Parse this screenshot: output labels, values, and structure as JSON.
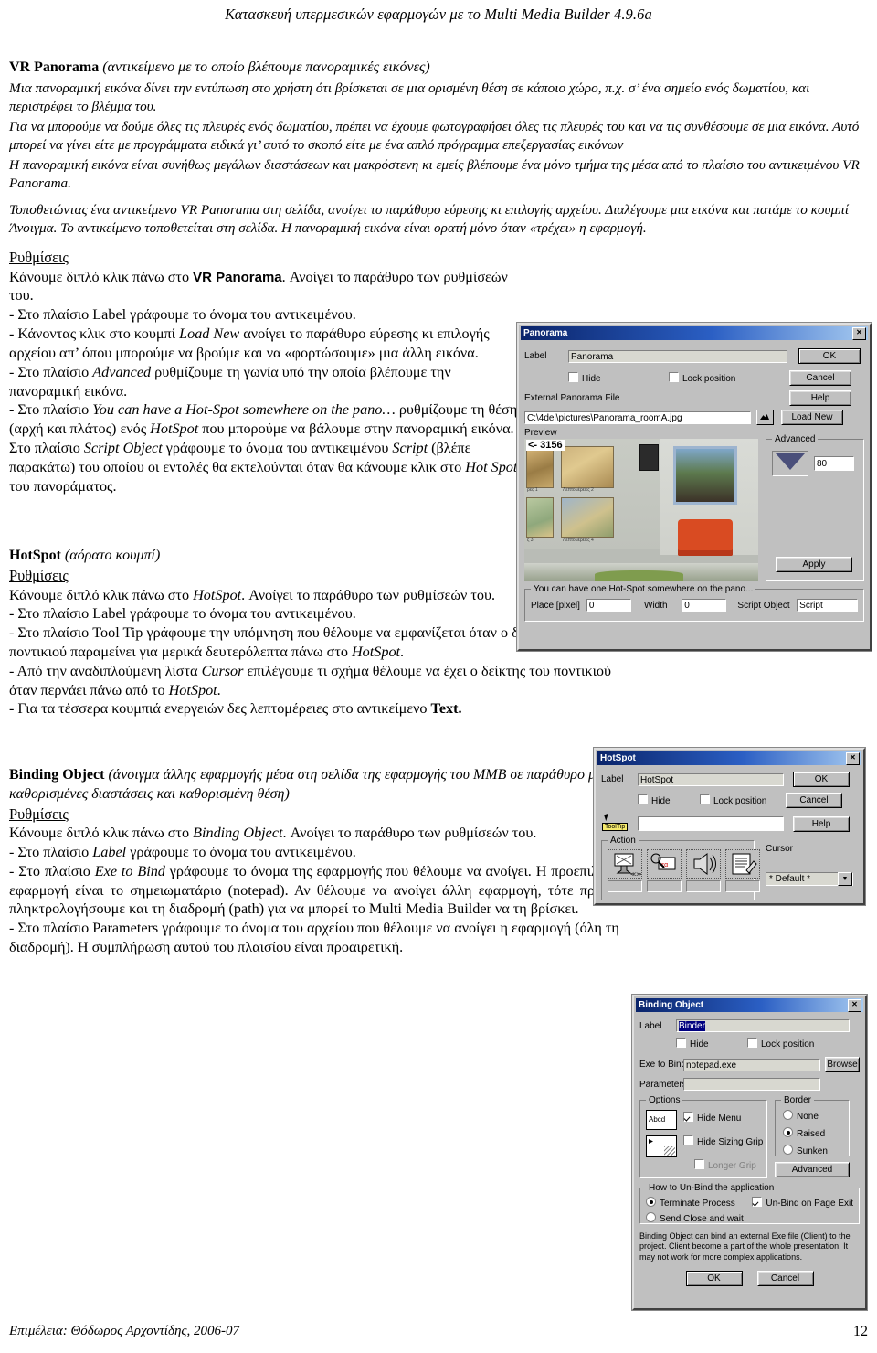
{
  "header": {
    "running_title": "Κατασκευή υπερμεσικών εφαρμογών με το Multi Media Builder 4.9.6a"
  },
  "footer": {
    "credit": "Επιμέλεια: Θόδωρος Αρχοντίδης, 2006-07",
    "page_number": "12"
  },
  "sections": {
    "vr_panorama": {
      "heading_bold": "VR Panorama",
      "heading_italic": " (αντικείμενο με το οποίο βλέπουμε πανοραμικές εικόνες)",
      "p1": "Μια πανοραμική εικόνα δίνει την εντύπωση στο χρήστη ότι βρίσκεται σε μια ορισμένη θέση σε κάποιο χώρο, π.χ. σ’ ένα σημείο ενός δωματίου, και περιστρέφει το βλέμμα του.",
      "p2": "Για να μπορούμε να δούμε όλες τις πλευρές ενός δωματίου, πρέπει να έχουμε φωτογραφήσει όλες τις πλευρές του και να τις συνθέσουμε σε μια εικόνα. Αυτό μπορεί να γίνει είτε με προγράμματα ειδικά γι’ αυτό το σκοπό είτε με ένα απλό πρόγραμμα επεξεργασίας εικόνων",
      "p3": "Η πανοραμική εικόνα είναι συνήθως μεγάλων διαστάσεων και μακρόστενη κι εμείς βλέπουμε ένα μόνο τμήμα της μέσα από το πλαίσιο του αντικειμένου VR Panorama.",
      "p4": "Τοποθετώντας ένα αντικείμενο VR Panorama στη σελίδα, ανοίγει το παράθυρο εύρεσης κι επιλογής αρχείου. Διαλέγουμε μια εικόνα και πατάμε το κουμπί Άνοιγμα. Το αντικείμενο τοποθετείται στη σελίδα. Η πανοραμική εικόνα είναι ορατή μόνο όταν «τρέχει» η εφαρμογή.",
      "settings_label": "Ρυθμίσεις",
      "s_intro": "Κάνουμε διπλό κλικ πάνω στο VR Panorama. Ανοίγει το παράθυρο των ρυθμίσεών του.",
      "s_item1": "- Στο πλαίσιο Label γράφουμε το όνομα του αντικειμένου.",
      "s_item2_a": "- Κάνοντας κλικ στο κουμπί ",
      "s_item2_i": "Load New",
      "s_item2_b": " ανοίγει το παράθυρο εύρεσης κι επιλογής αρχείου απ’ όπου μπορούμε να βρούμε και να «φορτώσουμε» μια άλλη εικόνα.",
      "s_item3_a": "- Στο πλαίσιο ",
      "s_item3_i": "Advanced",
      "s_item3_b": " ρυθμίζουμε τη γωνία υπό την οποία βλέπουμε την πανοραμική εικόνα.",
      "s_item4_a": "- Στο πλαίσιο ",
      "s_item4_i1": "You can have a Hot-Spot somewhere on the pano…",
      "s_item4_b": " ρυθμίζουμε τη θέση (αρχή και πλάτος) ενός ",
      "s_item4_i2": "HotSpot",
      "s_item4_c": " που μπορούμε να βάλουμε στην πανοραμική εικόνα. Στο πλαίσιο ",
      "s_item4_i3": "Script Object",
      "s_item4_d": " γράφουμε το όνομα του αντικειμένου ",
      "s_item4_i4": "Script",
      "s_item4_e": " (βλέπε παρακάτω) του οποίου οι εντολές θα εκτελούνται όταν θα κάνουμε κλικ στο ",
      "s_item4_i5": "Hot Spot",
      "s_item4_f": " του πανοράματος."
    },
    "hotspot": {
      "heading_bold": "HotSpot",
      "heading_italic": " (αόρατο κουμπί)",
      "settings_label": "Ρυθμίσεις",
      "s_intro_a": "Κάνουμε διπλό κλικ πάνω στο ",
      "s_intro_i": "HotSpot",
      "s_intro_b": ". Ανοίγει το παράθυρο των ρυθμίσεών του.",
      "s_item1": "- Στο πλαίσιο Label γράφουμε το όνομα του αντικειμένου.",
      "s_item2_a": "- Στο πλαίσιο Tool Tip γράφουμε την υπόμνηση που θέλουμε να εμφανίζεται όταν ο δείκτης του ποντικιού παραμείνει για μερικά δευτερόλεπτα πάνω στο ",
      "s_item2_i": "HotSpot",
      "s_item2_b": ".",
      "s_item3_a": "- Από την αναδιπλούμενη λίστα ",
      "s_item3_i": "Cursor",
      "s_item3_b": " επιλέγουμε τι σχήμα θέλουμε να έχει ο δείκτης του ποντικιού όταν περνάει πάνω από το ",
      "s_item3_i2": "HotSpot",
      "s_item3_c": ".",
      "s_item4_a": "- Για τα τέσσερα κουμπιά ενεργειών δες λεπτομέρειες στο αντικείμενο ",
      "s_item4_b": "Text."
    },
    "binding_object": {
      "heading_bold": "Binding Object",
      "heading_italic": " (άνοιγμα άλλης εφαρμογής μέσα στη σελίδα της εφαρμογής του MMB σε παράθυρο με καθορισμένες διαστάσεις και καθορισμένη θέση)",
      "settings_label": "Ρυθμίσεις",
      "s_intro_a": "Κάνουμε διπλό κλικ πάνω στο ",
      "s_intro_i": "Binding Object",
      "s_intro_b": ". Ανοίγει το παράθυρο των ρυθμίσεών του.",
      "s_item1_a": "- Στο πλαίσιο ",
      "s_item1_i": "Label",
      "s_item1_b": " γράφουμε το όνομα του αντικειμένου.",
      "s_item2_a": "- Στο πλαίσιο ",
      "s_item2_i": "Exe to Bind",
      "s_item2_b": " γράφουμε το όνομα της εφαρμογής που θέλουμε να ανοίγει. Η προεπιλεγμένη εφαρμογή είναι το σημειωματάριο (notepad). Αν θέλουμε να ανοίγει άλλη εφαρμογή, τότε πρέπει να πληκτρολογήσουμε και τη διαδρομή  (path) για να μπορεί το Multi Media Builder να τη βρίσκει.",
      "s_item3": "- Στο πλαίσιο Parameters γράφουμε το όνομα του αρχείου που θέλουμε να ανοίγει η εφαρμογή (όλη τη διαδρομή). Η συμπλήρωση αυτού του πλαισίου είναι προαιρετική."
    }
  },
  "dialogs": {
    "panorama": {
      "title": "Panorama",
      "close_label": "✕",
      "label_caption": "Label",
      "label_value": "Panorama",
      "hide_label": "Hide",
      "lock_label": "Lock position",
      "file_caption": "External Panorama File",
      "file_value": "C:\\4del\\pictures\\Panorama_roomA.jpg",
      "preview_caption": "Preview",
      "preview_tag": "<- 3156",
      "preview_captions": [
        "ρες 1",
        "Λεπτομέρειες 2",
        "ς 3",
        "Λεπτομέρειες 4"
      ],
      "advanced_caption": "Advanced",
      "advanced_value": "80",
      "apply_label": "Apply",
      "hotspot_group": "You can have one Hot-Spot somewhere on the pano...",
      "place_caption": "Place [pixel]",
      "place_value": "0",
      "width_caption": "Width",
      "width_value": "0",
      "script_caption": "Script Object",
      "script_value": "Script",
      "buttons": [
        "OK",
        "Cancel",
        "Help",
        "Load New"
      ]
    },
    "hotspot": {
      "title": "HotSpot",
      "close_label": "✕",
      "label_caption": "Label",
      "label_value": "HotSpot",
      "hide_label": "Hide",
      "lock_label": "Lock position",
      "tooltip_tag": "ToolTip",
      "tooltip_value": "",
      "action_caption": "Action",
      "cursor_caption": "Cursor",
      "cursor_value": "* Default *",
      "buttons": [
        "OK",
        "Cancel",
        "Help"
      ]
    },
    "binding": {
      "title": "Binding Object",
      "close_label": "✕",
      "label_caption": "Label",
      "label_value": "Binder",
      "hide_label": "Hide",
      "lock_label": "Lock position",
      "exe_caption": "Exe to Bind",
      "exe_value": "notepad.exe",
      "browse_label": "Browse",
      "params_caption": "Parameters",
      "params_value": "",
      "options_caption": "Options",
      "thumb_abcd": "Abcd",
      "hide_menu_label": "Hide Menu",
      "hide_sizing_label": "Hide Sizing Grip",
      "longer_grip_label": "Longer Grip",
      "border_caption": "Border",
      "border_none": "None",
      "border_raised": "Raised",
      "border_sunken": "Sunken",
      "advanced_label": "Advanced",
      "unbind_caption": "How to Un-Bind the application",
      "terminate_label": "Terminate Process",
      "sendclose_label": "Send Close and wait",
      "unbind_page_exit_label": "Un-Bind on Page Exit",
      "note": "Binding Object can bind an external Exe file (Client) to the project. Client become a part of the whole presentation. It may not work for more complex applications.",
      "ok_label": "OK",
      "cancel_label": "Cancel"
    }
  }
}
